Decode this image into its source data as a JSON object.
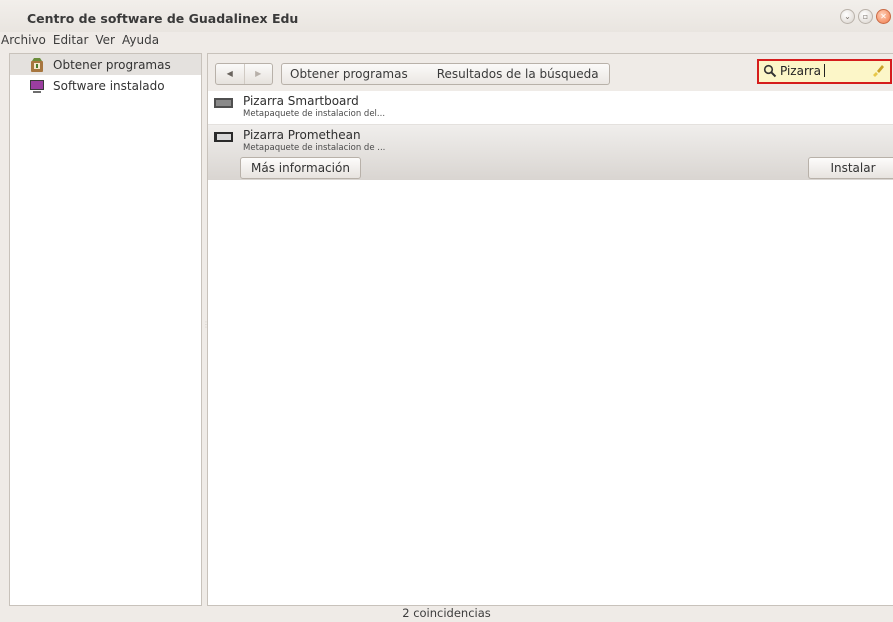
{
  "window": {
    "title": "Centro de software de Guadalinex Edu"
  },
  "menu": [
    "Archivo",
    "Editar",
    "Ver",
    "Ayuda"
  ],
  "sidebar": {
    "items": [
      {
        "label": "Obtener programas",
        "icon": "software-center-icon",
        "active": true
      },
      {
        "label": "Software instalado",
        "icon": "monitor-icon",
        "active": false
      }
    ]
  },
  "toolbar": {
    "back_glyph": "◀",
    "forward_glyph": "▶",
    "breadcrumbs": [
      "Obtener programas",
      "Resultados de la búsqueda"
    ],
    "search_value": "Pizarra"
  },
  "results": [
    {
      "name": "Pizarra Smartboard",
      "description": "Metapaquete de instalacion del..."
    },
    {
      "name": "Pizarra Promethean",
      "description": "Metapaquete de instalacion de ...",
      "selected": true,
      "more_label": "Más información",
      "install_label": "Instalar"
    }
  ],
  "status": "2 coincidencias",
  "colors": {
    "search_highlight_border": "#d51d1d",
    "search_background": "#fcf6c8"
  }
}
